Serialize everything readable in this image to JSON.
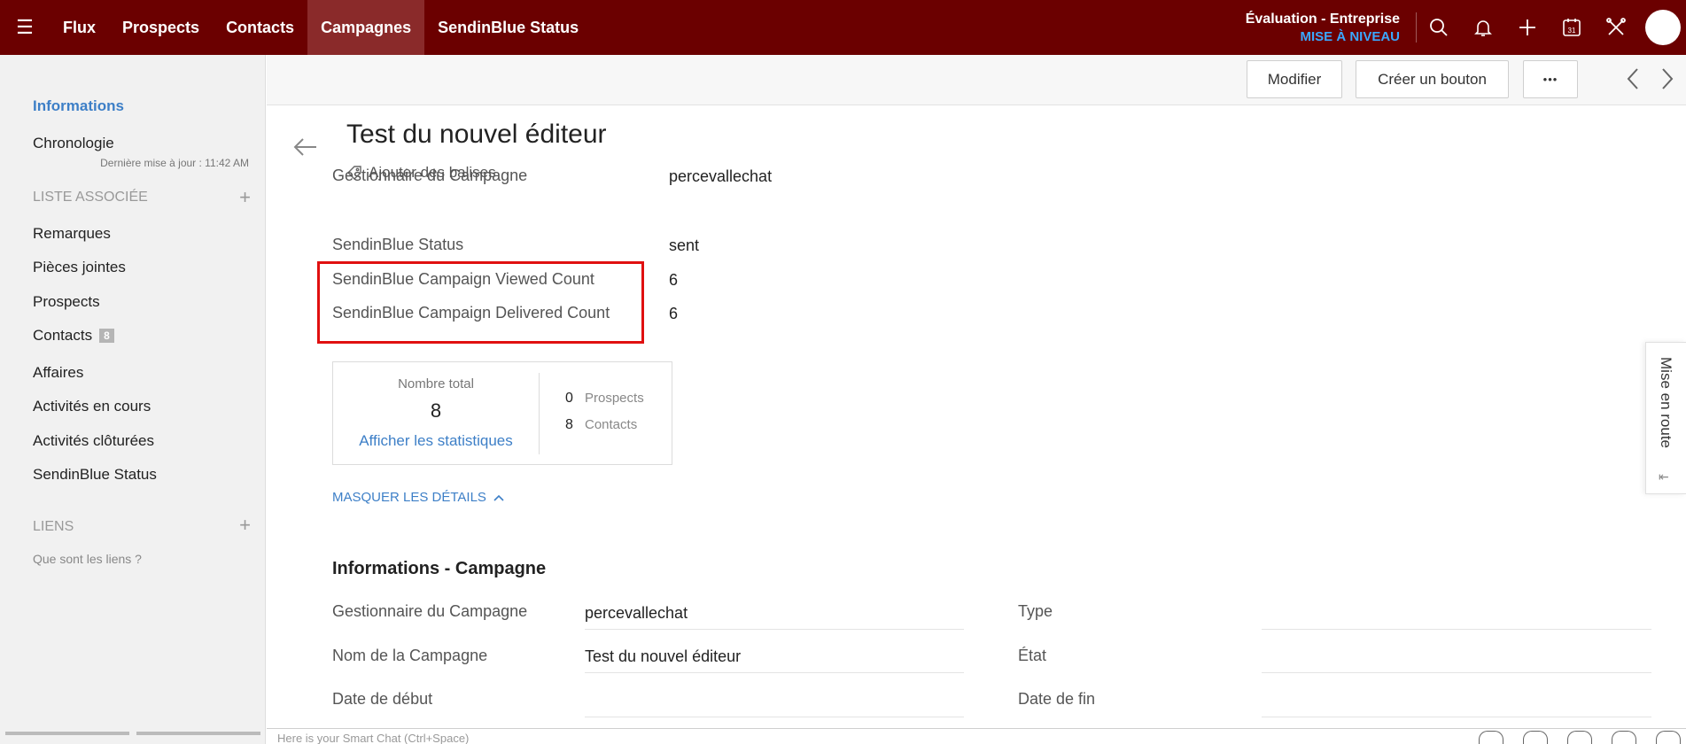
{
  "topbar": {
    "nav": [
      "Flux",
      "Prospects",
      "Contacts",
      "Campagnes",
      "SendinBlue Status"
    ],
    "active_nav": "Campagnes",
    "trial_title": "Évaluation - Entreprise",
    "trial_upgrade": "MISE À NIVEAU",
    "icons": [
      "search-icon",
      "bell-icon",
      "plus-icon",
      "calendar-icon",
      "tools-icon",
      "avatar"
    ],
    "calendar_day": "31"
  },
  "sidebar": {
    "informations": "Informations",
    "chronologie": "Chronologie",
    "last_update": "Dernière mise à jour : 11:42 AM",
    "related_list_title": "LISTE ASSOCIÉE",
    "related_items": [
      "Remarques",
      "Pièces jointes",
      "Prospects",
      "Contacts",
      "Affaires",
      "Activités en cours",
      "Activités clôturées",
      "SendinBlue Status"
    ],
    "contacts_badge": "8",
    "links_title": "LIENS",
    "links_help": "Que sont les liens ?"
  },
  "actionbar": {
    "edit_label": "Modifier",
    "create_button_label": "Créer un bouton",
    "more_label": "•••"
  },
  "record": {
    "title": "Test du nouvel éditeur",
    "add_tags": "Ajouter des balises",
    "summary_fields": [
      {
        "label": "Gestionnaire du Campagne",
        "value": "percevallechat"
      },
      {
        "label": "SendinBlue Status",
        "value": "sent"
      },
      {
        "label": "SendinBlue Campaign Viewed Count",
        "value": "6"
      },
      {
        "label": "SendinBlue Campaign Delivered Count",
        "value": "6"
      }
    ],
    "stats": {
      "caption": "Nombre total",
      "total": "8",
      "link": "Afficher les statistiques",
      "prospects_count": "0",
      "prospects_label": "Prospects",
      "contacts_count": "8",
      "contacts_label": "Contacts"
    },
    "hide_details": "MASQUER LES DÉTAILS",
    "section_title": "Informations - Campagne",
    "details_left": [
      {
        "label": "Gestionnaire du Campagne",
        "value": "percevallechat"
      },
      {
        "label": "Nom de la Campagne",
        "value": "Test du nouvel éditeur"
      },
      {
        "label": "Date de début",
        "value": ""
      }
    ],
    "details_right": [
      {
        "label": "Type",
        "value": ""
      },
      {
        "label": "État",
        "value": ""
      },
      {
        "label": "Date de fin",
        "value": ""
      }
    ]
  },
  "getting_started": "Mise en route",
  "bottombar": {
    "chat_hint": "Here is your Smart Chat (Ctrl+Space)"
  },
  "colors": {
    "topbar_bg": "#6b0000",
    "active_nav_bg": "#8a2a2a",
    "upgrade": "#3aa8ff",
    "link": "#3d7fc7",
    "highlight": "#e01010"
  }
}
